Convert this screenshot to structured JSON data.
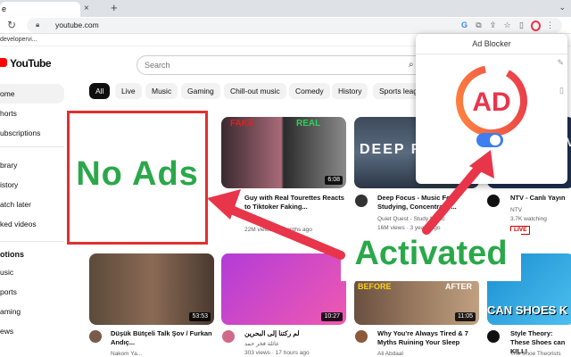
{
  "browser": {
    "tab_title": "e",
    "tab_close": "×",
    "new_tab": "+",
    "tab_menu": "⌄",
    "url": "youtube.com",
    "bookmark": "developervi..."
  },
  "youtube": {
    "logo_text": "YouTube",
    "search_placeholder": "Search",
    "sidebar": {
      "items": [
        {
          "label": "Home",
          "shown": "ome",
          "active": true
        },
        {
          "label": "Shorts",
          "shown": "horts"
        },
        {
          "label": "Subscriptions",
          "shown": "ubscriptions"
        },
        {
          "label": "Library",
          "shown": "brary"
        },
        {
          "label": "History",
          "shown": "istory"
        },
        {
          "label": "Watch later",
          "shown": "atch later"
        },
        {
          "label": "Liked videos",
          "shown": "ked videos"
        }
      ],
      "section_title": "otions",
      "section_items": [
        "usic",
        "ports",
        "aming",
        "ews"
      ]
    },
    "chips": [
      "All",
      "Live",
      "Music",
      "Gaming",
      "Chill-out music",
      "Comedy",
      "History",
      "Sports leag"
    ],
    "videos_row1": [
      {
        "title": "Guy with Real Tourettes Reacts to Tiktoker Faking...",
        "channel": "",
        "meta": "22M views · 3 months ago",
        "duration": "6:08",
        "thumb_labels": [
          "FAKE",
          "REAL"
        ]
      },
      {
        "title": "Deep Focus - Music For Studying, Concentratio...",
        "channel": "Quiet Quest - Study Music",
        "meta": "16M views · 3 years ago",
        "duration": "",
        "thumb_labels": [
          "DEEP F"
        ]
      },
      {
        "title": "NTV - Canlı Yayın",
        "channel": "NTV",
        "meta": "3.7K watching",
        "badge": "LIVE",
        "thumb_labels": [
          "NTV"
        ]
      }
    ],
    "videos_row2": [
      {
        "title": "Düşük Bütçeli Talk Şov / Furkan Andıç...",
        "channel": "Nakom Ya...",
        "meta": "",
        "duration": "53:53"
      },
      {
        "title": "لم رکتنا إلى البحرين",
        "channel": "عائلة فخر حمد",
        "meta": "303 views · 17 hours ago",
        "duration": "10:27"
      },
      {
        "title": "Why You're Always Tired & 7 Myths Ruining Your Sleep",
        "channel": "Ali Abdaal",
        "meta": "",
        "duration": "11:05",
        "thumb_labels": [
          "BEFORE",
          "AFTER"
        ]
      },
      {
        "title": "Style Theory: These Shoes can KILL!",
        "channel": "The Shoe Theorists",
        "meta": "",
        "duration": "",
        "thumb_labels": [
          "CAN SHOES K"
        ]
      }
    ]
  },
  "overlay": {
    "no_ads": "No Ads",
    "activated": "Activated",
    "popup_title": "Ad Blocker",
    "logo_text": "AD",
    "toggle_on": true
  },
  "colors": {
    "green": "#2aa84a",
    "red": "#e03030",
    "logo_red": "#e8354a",
    "toggle_blue": "#3d7ef0"
  }
}
